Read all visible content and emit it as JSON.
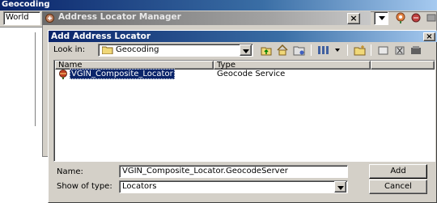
{
  "geocoding_toolbar": {
    "title": "Geocoding",
    "combo_value": "World"
  },
  "locator_manager": {
    "title": "Address Locator Manager"
  },
  "dialog": {
    "title": "Add Address Locator",
    "look_in_label": "Look in:",
    "look_in_value": "Geocoding",
    "columns": [
      "Name",
      "Type"
    ],
    "rows": [
      {
        "name": "VGIN_Composite_Locator",
        "type": "Geocode Service",
        "selected": true,
        "icon": "geocode-service-icon"
      }
    ],
    "name_label": "Name:",
    "name_value": "VGIN_Composite_Locator.GeocodeServer",
    "show_type_label": "Show of type:",
    "show_type_value": "Locators",
    "add_button": "Add",
    "cancel_button": "Cancel",
    "close_glyph": "×"
  },
  "colors": {
    "title_active": "#0a246a",
    "title_active_end": "#a6caf0",
    "face": "#d4d0c8",
    "selection": "#0a246a"
  }
}
